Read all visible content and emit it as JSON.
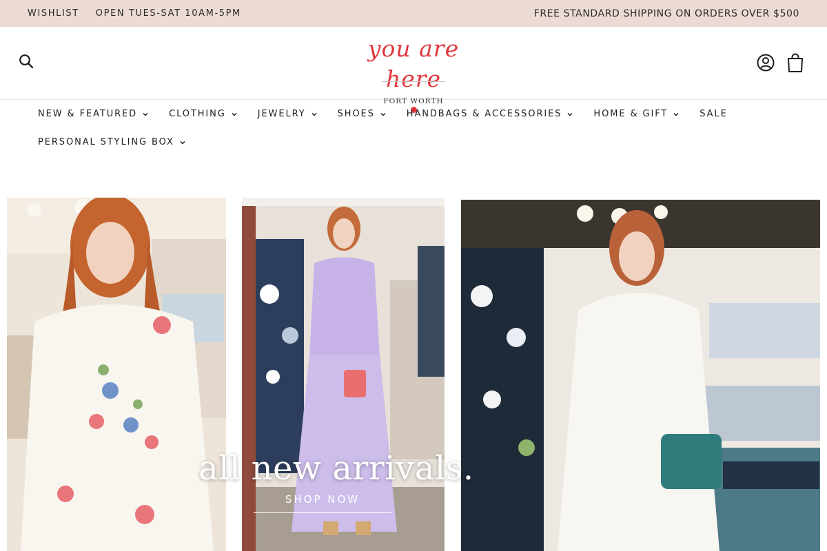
{
  "topbar": {
    "wishlist": "WISHLIST",
    "hours": "OPEN TUES-SAT 10AM-5PM",
    "shipping": "FREE STANDARD SHIPPING ON ORDERS OVER $500"
  },
  "header": {
    "logo_script": "you are here",
    "logo_location": "FORT WORTH",
    "icons": [
      "search-icon",
      "account-icon",
      "cart-icon"
    ]
  },
  "nav": {
    "items": [
      {
        "label": "NEW & FEATURED",
        "dropdown": true
      },
      {
        "label": "CLOTHING",
        "dropdown": true
      },
      {
        "label": "JEWELRY",
        "dropdown": true
      },
      {
        "label": "SHOES",
        "dropdown": true
      },
      {
        "label": "HANDBAGS & ACCESSORIES",
        "dropdown": true
      },
      {
        "label": "HOME & GIFT",
        "dropdown": true
      },
      {
        "label": "SALE",
        "dropdown": false
      },
      {
        "label": "PERSONAL STYLING BOX",
        "dropdown": true
      }
    ]
  },
  "hero": {
    "title": "all new arrivals.",
    "cta": "SHOP NOW"
  },
  "colors": {
    "topbar_bg": "#ecdbd5",
    "brand_red": "#e2363c",
    "text": "#1c1c1c"
  }
}
